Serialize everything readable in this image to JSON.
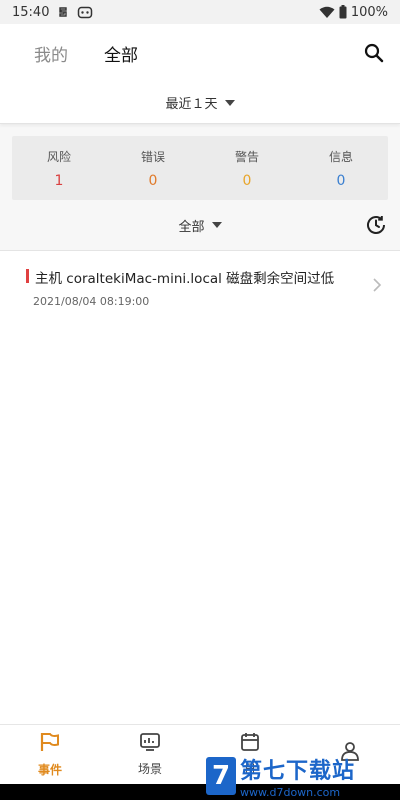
{
  "status_bar": {
    "time": "15:40",
    "battery_text": "100%"
  },
  "header": {
    "tab_mine": "我的",
    "tab_all": "全部",
    "range_label": "最近１天"
  },
  "summary": [
    {
      "label": "风险",
      "count": "1",
      "color": "#d94040"
    },
    {
      "label": "错误",
      "count": "0",
      "color": "#e07a2a"
    },
    {
      "label": "警告",
      "count": "0",
      "color": "#e8a52a"
    },
    {
      "label": "信息",
      "count": "0",
      "color": "#3a7fd0"
    }
  ],
  "filter": {
    "label": "全部"
  },
  "events": [
    {
      "title": "主机 coraltekiMac-mini.local 磁盘剩余空间过低",
      "time": "2021/08/04 08:19:00",
      "severity_color": "#e04040"
    }
  ],
  "bottom_nav": [
    {
      "label": "事件",
      "icon": "flag-icon",
      "active": true
    },
    {
      "label": "场景",
      "icon": "monitor-icon",
      "active": false
    },
    {
      "label": "日",
      "icon": "calendar-icon",
      "active": false
    },
    {
      "label": "",
      "icon": "person-icon",
      "active": false
    }
  ],
  "watermark": {
    "badge": "7",
    "title": "第七下载站",
    "url": "www.d7down.com"
  },
  "colors": {
    "accent": "#e08a1e",
    "watermark": "#1c66c9"
  }
}
